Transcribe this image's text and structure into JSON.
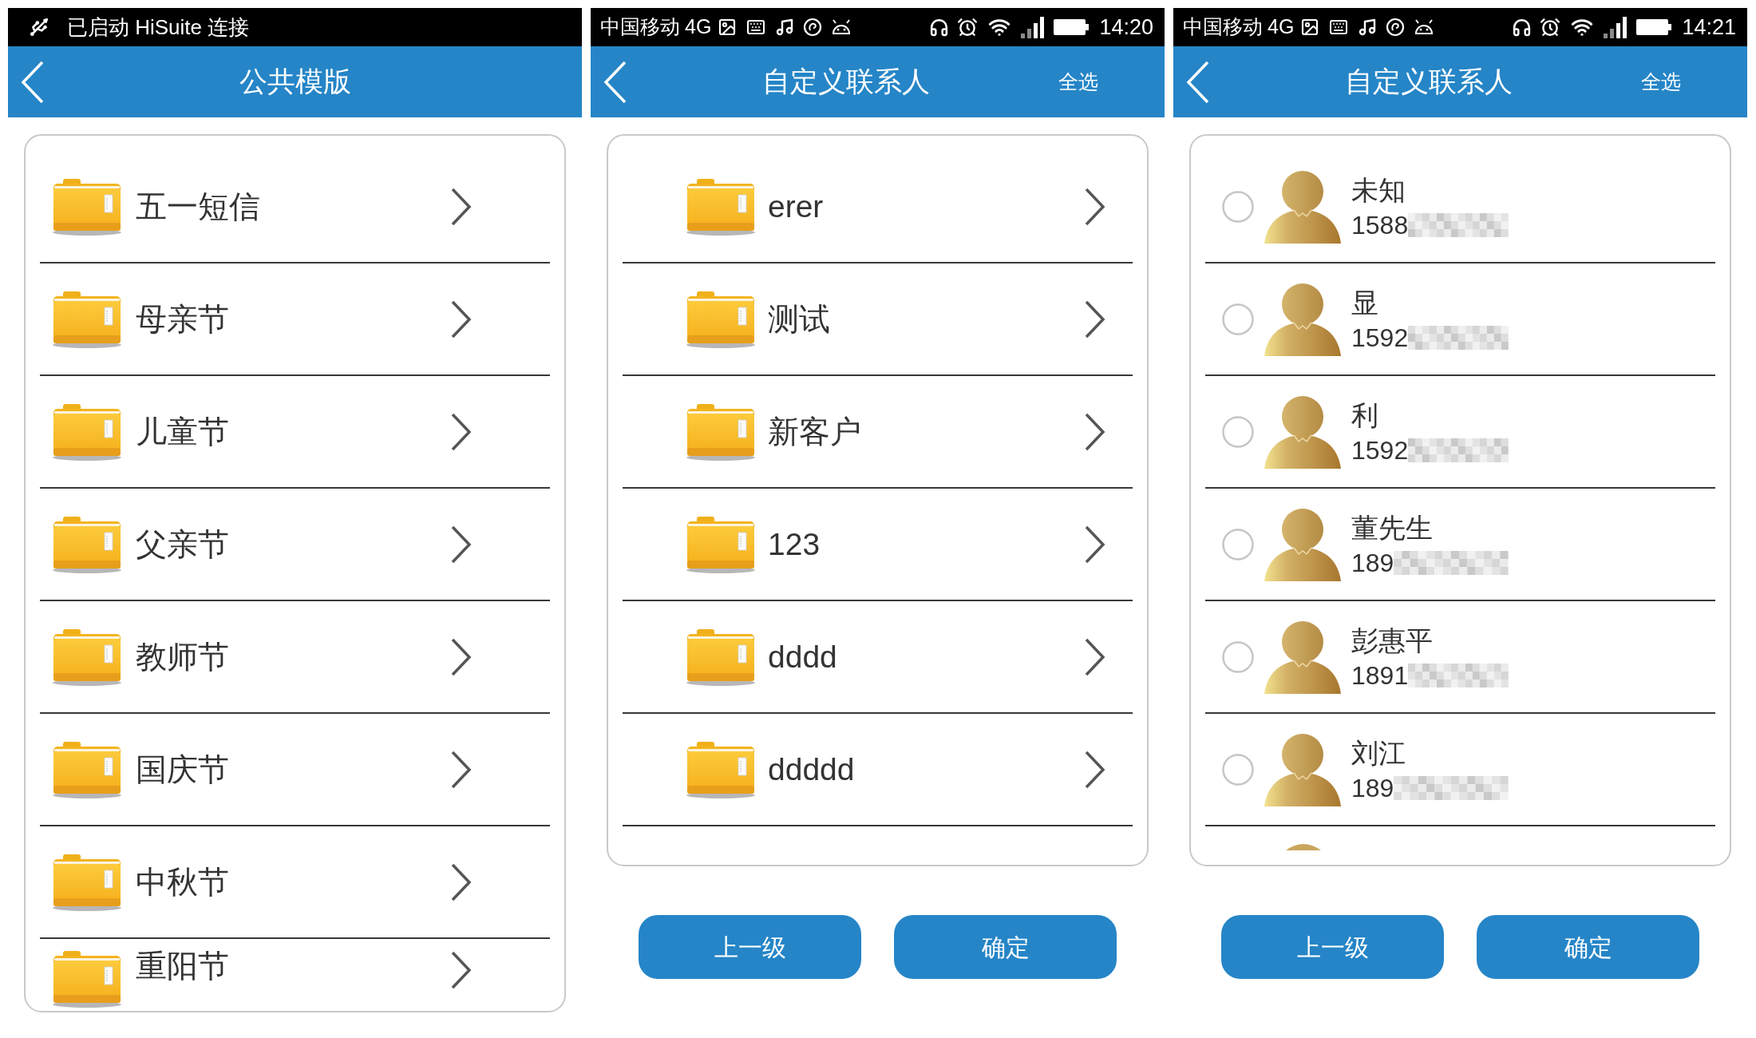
{
  "screens": [
    {
      "kind": "templates",
      "status_bar": {
        "kind": "notification",
        "text": "已启动 HiSuite 连接"
      },
      "header": {
        "title": "公共模版"
      },
      "folders": [
        {
          "name": "五一短信",
          "cut_off": false
        },
        {
          "name": "母亲节",
          "cut_off": false
        },
        {
          "name": "儿童节",
          "cut_off": false
        },
        {
          "name": "父亲节",
          "cut_off": false
        },
        {
          "name": "教师节",
          "cut_off": false
        },
        {
          "name": "国庆节",
          "cut_off": false
        },
        {
          "name": "中秋节",
          "cut_off": false
        },
        {
          "name": "重阳节",
          "cut_off": true
        }
      ]
    },
    {
      "kind": "groups",
      "status_bar": {
        "kind": "system",
        "carrier": "中国移动",
        "network": "4G",
        "time": "14:20"
      },
      "header": {
        "title": "自定义联系人",
        "action": "全选"
      },
      "folders": [
        {
          "name": "erer",
          "cut_off": false
        },
        {
          "name": "测试",
          "cut_off": false
        },
        {
          "name": "新客户",
          "cut_off": false
        },
        {
          "name": "123",
          "cut_off": false
        },
        {
          "name": "dddd",
          "cut_off": false
        },
        {
          "name": "ddddd",
          "cut_off": false
        }
      ],
      "buttons": [
        {
          "label": "上一级"
        },
        {
          "label": "确定"
        }
      ]
    },
    {
      "kind": "contacts",
      "status_bar": {
        "kind": "system",
        "carrier": "中国移动",
        "network": "4G",
        "time": "14:21"
      },
      "header": {
        "title": "自定义联系人",
        "action": "全选"
      },
      "contacts": [
        {
          "name": "未知",
          "number": "1588",
          "selected": false
        },
        {
          "name": "显",
          "number": "1592",
          "selected": false
        },
        {
          "name": "利",
          "number": "1592",
          "selected": false
        },
        {
          "name": "董先生",
          "number": "189",
          "selected": false
        },
        {
          "name": "彭惠平",
          "number": "1891",
          "selected": false
        },
        {
          "name": "刘江",
          "number": "189",
          "selected": false
        }
      ],
      "more_below": true,
      "buttons": [
        {
          "label": "上一级"
        },
        {
          "label": "确定"
        }
      ]
    }
  ]
}
